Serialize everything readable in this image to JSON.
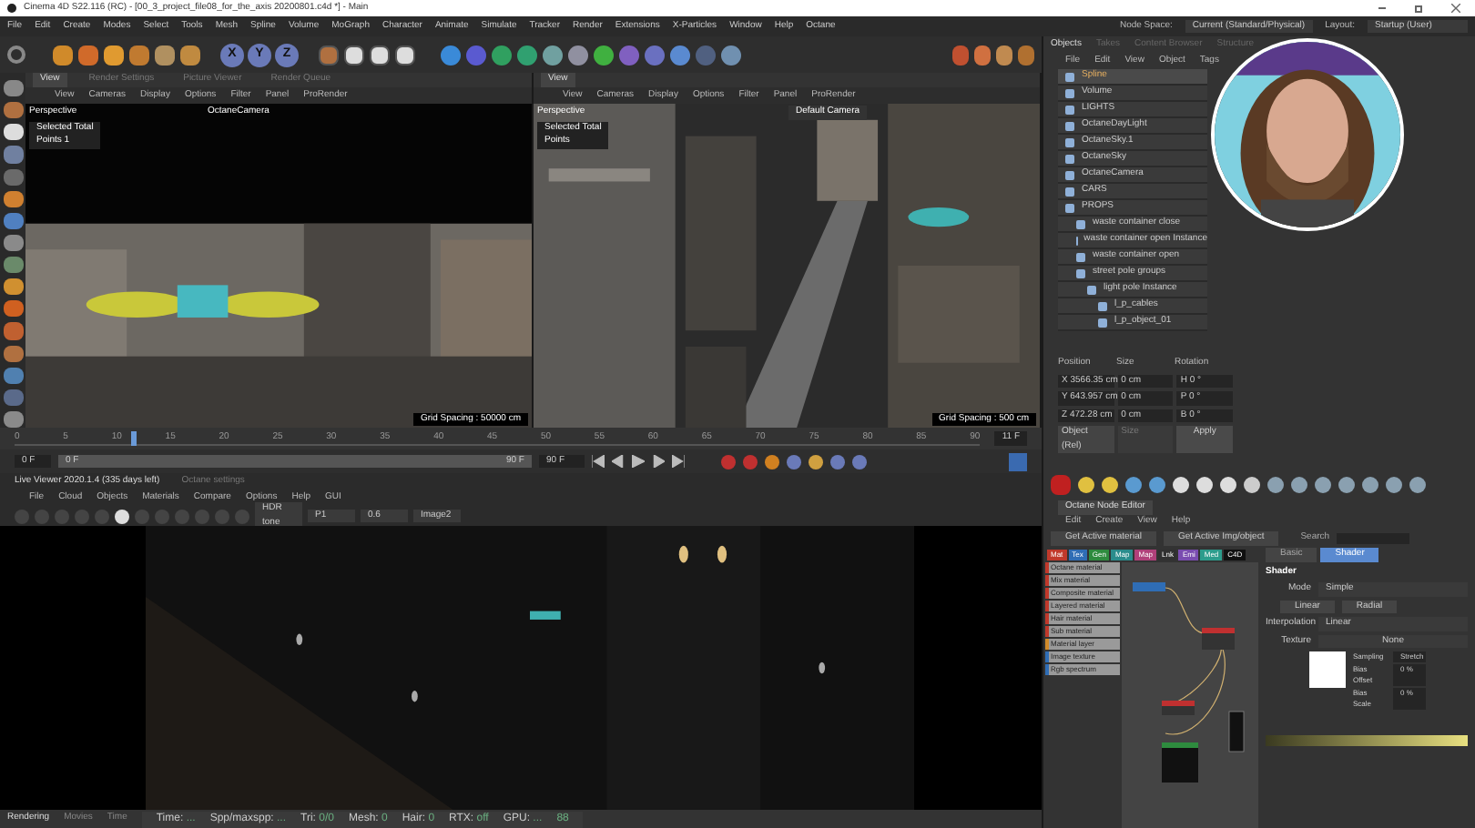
{
  "window": {
    "title": "Cinema 4D S22.116 (RC) - [00_3_project_file08_for_the_axis 20200801.c4d *] - Main"
  },
  "menu": [
    "File",
    "Edit",
    "Create",
    "Modes",
    "Select",
    "Tools",
    "Mesh",
    "Spline",
    "Volume",
    "MoGraph",
    "Character",
    "Animate",
    "Simulate",
    "Tracker",
    "Render",
    "Extensions",
    "X-Particles",
    "Window",
    "Help",
    "Octane"
  ],
  "node_space": {
    "label": "Node Space:",
    "value": "Current (Standard/Physical)"
  },
  "layout": {
    "label": "Layout:",
    "value": "Startup (User)"
  },
  "toolbar": {
    "axes": [
      {
        "label": "X",
        "on": true
      },
      {
        "label": "Y",
        "on": true
      },
      {
        "label": "Z",
        "on": true
      }
    ]
  },
  "viewports": [
    {
      "tabs": [
        {
          "label": "View",
          "selected": true
        },
        {
          "label": "Render Settings",
          "selected": false
        },
        {
          "label": "Picture Viewer",
          "selected": false
        },
        {
          "label": "Render Queue",
          "selected": false
        }
      ],
      "menu": [
        "View",
        "Cameras",
        "Display",
        "Options",
        "Filter",
        "Panel",
        "ProRender"
      ],
      "projection": "Perspective",
      "camera": "OctaneCamera",
      "hud_title": "Selected Total",
      "hud_label": "Points",
      "hud_value": "1",
      "grid": "Grid Spacing : 50000 cm"
    },
    {
      "tabs": [
        {
          "label": "View",
          "selected": true
        }
      ],
      "menu": [
        "View",
        "Cameras",
        "Display",
        "Options",
        "Filter",
        "Panel",
        "ProRender"
      ],
      "projection": "Perspective",
      "camera": "Default Camera",
      "hud_title": "Selected Total",
      "hud_label": "Points",
      "grid": "Grid Spacing : 500 cm"
    }
  ],
  "timeline": {
    "ticks": [
      "0",
      "5",
      "10",
      "15",
      "20",
      "25",
      "30",
      "35",
      "40",
      "45",
      "50",
      "55",
      "60",
      "65",
      "70",
      "75",
      "80",
      "85",
      "90"
    ],
    "current": "11 F",
    "start": "0 F",
    "range": {
      "start": "0 F",
      "end": "90 F",
      "level": 1
    },
    "end": "90 F",
    "playhead": {
      "level": 0.12
    }
  },
  "live_viewer": {
    "title": "Live Viewer 2020.1.4 (335 days left)",
    "settings": "Octane settings",
    "menu": [
      "File",
      "Cloud",
      "Objects",
      "Materials",
      "Compare",
      "Options",
      "Help",
      "GUI"
    ],
    "dropdowns": [
      "HDR tone",
      "P1",
      "0.6",
      "Image2"
    ],
    "stats": [
      {
        "label": "Time:",
        "value": "..."
      },
      {
        "label": "Spp/maxspp:",
        "value": "..."
      },
      {
        "label": "Tri:",
        "value": "0/0"
      },
      {
        "label": "Mesh:",
        "value": "0"
      },
      {
        "label": "Hair:",
        "value": "0"
      },
      {
        "label": "RTX:",
        "value": "off"
      },
      {
        "label": "GPU:",
        "value": "..."
      },
      {
        "value": "88"
      }
    ],
    "tabs": [
      {
        "label": "Rendering",
        "selected": true
      },
      {
        "label": "Movies",
        "selected": false
      },
      {
        "label": "Time",
        "selected": false
      }
    ]
  },
  "objects": {
    "tabs": [
      {
        "label": "Objects",
        "selected": true
      },
      {
        "label": "Takes",
        "selected": false
      },
      {
        "label": "Content Browser",
        "selected": false
      },
      {
        "label": "Structure",
        "selected": false
      }
    ],
    "menu": [
      "File",
      "Edit",
      "View",
      "Object",
      "Tags"
    ],
    "tree": [
      {
        "name": "Spline",
        "selected": true
      },
      {
        "name": "Volume",
        "selected": false
      },
      {
        "name": "LIGHTS",
        "selected": false
      },
      {
        "name": "OctaneDayLight",
        "selected": false
      },
      {
        "name": "OctaneSky.1",
        "selected": false
      },
      {
        "name": "OctaneSky",
        "selected": false
      },
      {
        "name": "OctaneCamera",
        "selected": false
      },
      {
        "name": "CARS",
        "selected": false
      },
      {
        "name": "PROPS",
        "selected": false,
        "children": [
          {
            "name": "waste container close",
            "selected": false
          },
          {
            "name": "waste container open Instance",
            "selected": false
          },
          {
            "name": "waste container open",
            "selected": false
          },
          {
            "name": "street pole groups",
            "selected": false,
            "children": [
              {
                "name": "light pole Instance",
                "selected": false,
                "children": [
                  {
                    "name": "l_p_cables",
                    "selected": false
                  },
                  {
                    "name": "l_p_object_01",
                    "selected": false
                  }
                ]
              }
            ]
          }
        ]
      }
    ]
  },
  "coordinates": {
    "headers": [
      "Position",
      "Size",
      "Rotation"
    ],
    "rows": [
      {
        "axis": "X",
        "position": "3566.35 cm",
        "size": "0 cm",
        "rot_axis": "H",
        "rotation": "0 °"
      },
      {
        "axis": "Y",
        "position": "643.957 cm",
        "size": "0 cm",
        "rot_axis": "P",
        "rotation": "0 °"
      },
      {
        "axis": "Z",
        "position": "472.28 cm",
        "size": "0 cm",
        "rot_axis": "B",
        "rotation": "0 °"
      }
    ],
    "mode": "Object (Rel)",
    "size_mode": "Size",
    "apply": "Apply"
  },
  "node_editor": {
    "tabs": [
      {
        "label": "Octane Node Editor",
        "selected": true
      }
    ],
    "menu": [
      "Edit",
      "Create",
      "View",
      "Help"
    ],
    "buttons": [
      "Get Active material",
      "Get Active Img/object"
    ],
    "search": "Search",
    "categories": [
      {
        "label": "Mat",
        "color": "#c0392b"
      },
      {
        "label": "Tex",
        "color": "#2f6db5"
      },
      {
        "label": "Gen",
        "color": "#2e8b3e"
      },
      {
        "label": "Map",
        "color": "#2a8c8c"
      },
      {
        "label": "Map",
        "color": "#b0407a"
      },
      {
        "label": "Lnk",
        "color": "#303030"
      },
      {
        "label": "Emi",
        "color": "#7a4cb0"
      },
      {
        "label": "Med",
        "color": "#2c9c8c"
      },
      {
        "label": "C4D",
        "color": "#101010"
      }
    ],
    "materials": [
      {
        "name": "Octane material",
        "color": "#c0392b",
        "selected": false
      },
      {
        "name": "Mix material",
        "color": "#c0392b",
        "selected": false
      },
      {
        "name": "Composite material",
        "color": "#c0392b",
        "selected": false
      },
      {
        "name": "Layered material",
        "color": "#c0392b",
        "selected": false
      },
      {
        "name": "Hair material",
        "color": "#c0392b",
        "selected": false
      },
      {
        "name": "Sub material",
        "color": "#c0392b",
        "selected": false
      },
      {
        "name": "Material layer",
        "color": "#d08a2a",
        "selected": false
      },
      {
        "name": "Image texture",
        "color": "#2f6db5",
        "selected": false
      },
      {
        "name": "Rgb spectrum",
        "color": "#2f6db5",
        "selected": false
      }
    ],
    "attr_tabs": [
      {
        "label": "Basic",
        "selected": false
      },
      {
        "label": "Shader",
        "selected": true
      }
    ],
    "section": "Shader",
    "mode_label": "Mode",
    "mode": "Simple",
    "type_buttons": [
      {
        "label": "Linear",
        "selected": false
      },
      {
        "label": "Radial",
        "selected": false
      }
    ],
    "interp_label": "Interpolation",
    "interp": "Linear",
    "texture_label": "Texture",
    "texture": "None",
    "params": [
      {
        "label": "Sampling",
        "value": "Stretch"
      },
      {
        "label": "Bias Offset",
        "value": "0 %"
      },
      {
        "label": "Bias Scale",
        "value": "0 %"
      }
    ]
  }
}
